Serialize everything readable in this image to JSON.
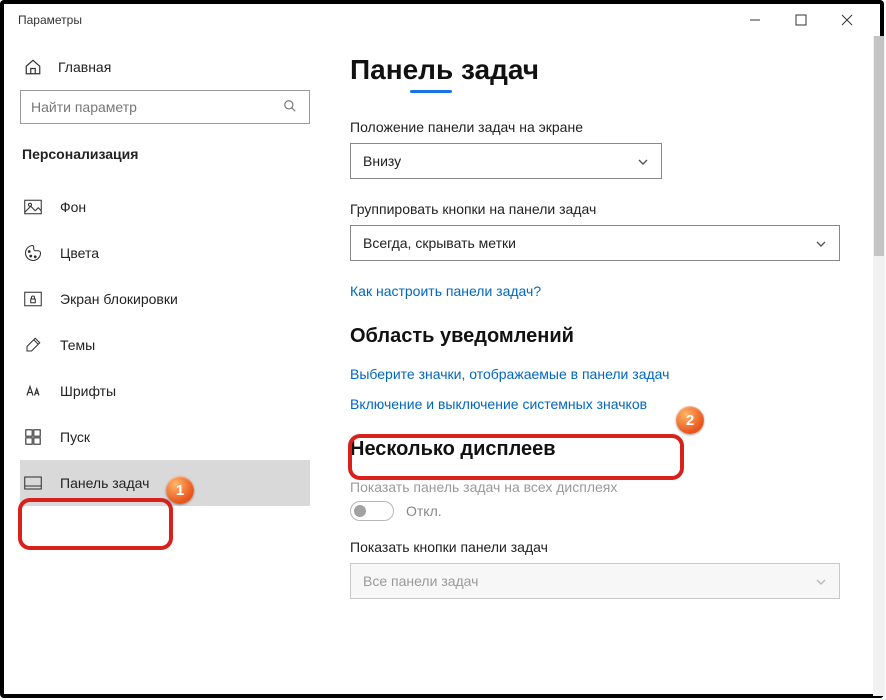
{
  "titlebar": {
    "title": "Параметры"
  },
  "sidebar": {
    "home": "Главная",
    "search_placeholder": "Найти параметр",
    "section": "Персонализация",
    "items": [
      {
        "label": "Фон"
      },
      {
        "label": "Цвета"
      },
      {
        "label": "Экран блокировки"
      },
      {
        "label": "Темы"
      },
      {
        "label": "Шрифты"
      },
      {
        "label": "Пуск"
      },
      {
        "label": "Панель задач"
      }
    ]
  },
  "main": {
    "title": "Панель задач",
    "position_label": "Положение панели задач на экране",
    "position_value": "Внизу",
    "group_label": "Группировать кнопки на панели задач",
    "group_value": "Всегда, скрывать метки",
    "help_link": "Как настроить панели задач?",
    "notif_heading": "Область уведомлений",
    "notif_link1": "Выберите значки, отображаемые в панели задач",
    "notif_link2": "Включение и выключение системных значков",
    "multi_heading": "Несколько дисплеев",
    "multi_label": "Показать панель задач на всех дисплеях",
    "toggle_state": "Откл.",
    "multi_btns_label": "Показать кнопки панели задач",
    "multi_btns_value": "Все панели задач"
  },
  "annotations": {
    "badge1": "1",
    "badge2": "2"
  }
}
